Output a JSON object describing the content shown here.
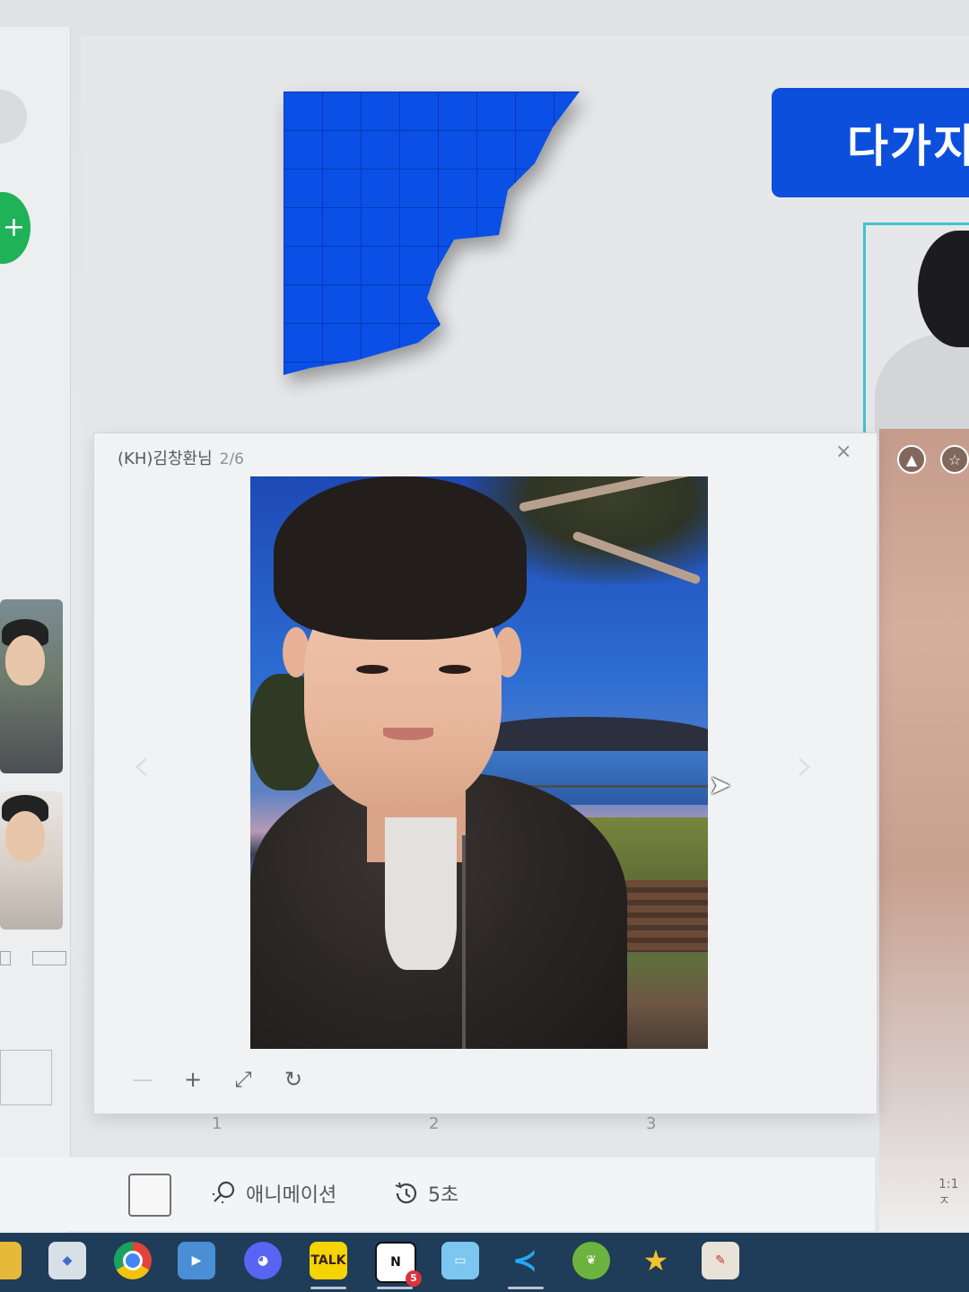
{
  "slide": {
    "title_badge": "다가지"
  },
  "viewer": {
    "sender": "(KH)김창환님",
    "counter": "2/6",
    "close_icon": "×",
    "prev_icon": "‹",
    "next_icon": "›",
    "zoom_out": "—",
    "zoom_in": "+",
    "fit": "⤢",
    "rotate": "↻"
  },
  "pages": [
    "1",
    "2",
    "3"
  ],
  "toolbar": {
    "animation_label": "애니메이션",
    "duration_label": "5초",
    "animation_icon": "rocket-icon",
    "duration_icon": "history-icon"
  },
  "right_panel": {
    "ratio_label": "1:1 ㅈ"
  },
  "taskbar": {
    "apps": [
      {
        "name": "explorer",
        "label": ""
      },
      {
        "name": "paint-3d",
        "label": ""
      },
      {
        "name": "chrome",
        "label": ""
      },
      {
        "name": "media-player",
        "label": ""
      },
      {
        "name": "discord",
        "label": ""
      },
      {
        "name": "kakaotalk",
        "label": "TALK"
      },
      {
        "name": "notion",
        "label": "N"
      },
      {
        "name": "notepad",
        "label": ""
      },
      {
        "name": "vscode",
        "label": ""
      },
      {
        "name": "spring",
        "label": ""
      },
      {
        "name": "star-app",
        "label": ""
      },
      {
        "name": "paint",
        "label": ""
      }
    ],
    "notion_badge": "5"
  }
}
